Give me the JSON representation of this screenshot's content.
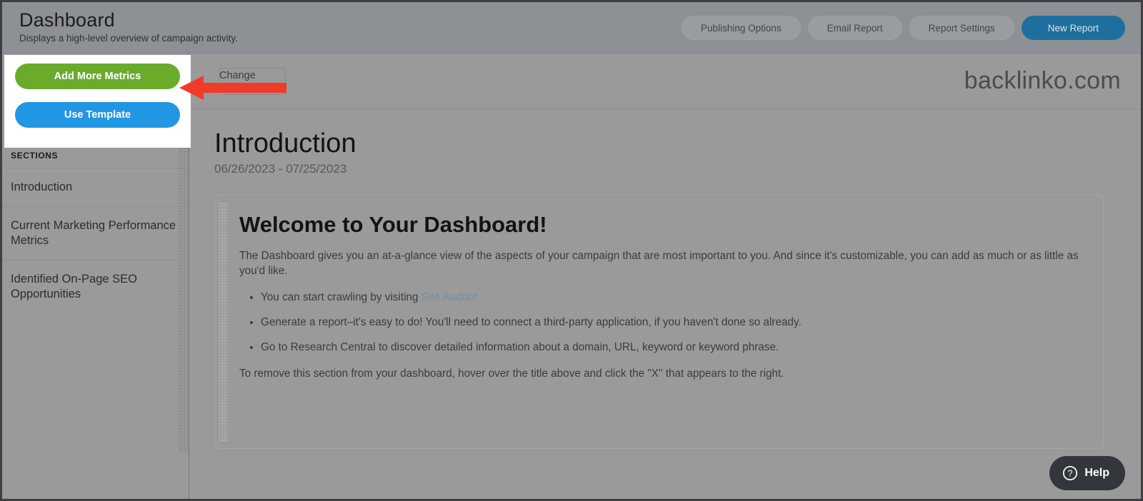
{
  "header": {
    "title": "Dashboard",
    "subtitle": "Displays a high-level overview of campaign activity.",
    "actions": [
      {
        "label": "Publishing Options",
        "style": "outline"
      },
      {
        "label": "Email Report",
        "style": "outline"
      },
      {
        "label": "Report Settings",
        "style": "outline"
      },
      {
        "label": "New Report",
        "style": "primary",
        "color": "#1f6f9e"
      }
    ]
  },
  "highlight_panel": {
    "add_metrics_label": "Add More Metrics",
    "add_metrics_color": "#6aab2c",
    "use_template_label": "Use Template",
    "use_template_color": "#2196e3"
  },
  "annotation": {
    "arrow_color": "#f23a28",
    "arrow_direction": "left",
    "points_at": "Add More Metrics"
  },
  "sidebar": {
    "sections_label": "SECTIONS",
    "items": [
      {
        "label": "Introduction"
      },
      {
        "label": "Current Marketing Performance Metrics"
      },
      {
        "label": "Identified On-Page SEO Opportunities"
      }
    ]
  },
  "brandbar": {
    "logo_button_label": "Change Logo",
    "domain": "backlinko.com"
  },
  "content": {
    "heading": "Introduction",
    "date_range": "06/26/2023 - 07/25/2023",
    "card": {
      "title": "Welcome to Your Dashboard!",
      "intro": "The Dashboard gives you an at-a-glance view of the aspects of your campaign that are most important to you. And since it's customizable, you can add as much or as little as you'd like.",
      "bullets": [
        {
          "text_before": "You can start crawling by visiting ",
          "link": "Site Auditor",
          "text_after": ""
        },
        {
          "text_before": "Generate a report–it's easy to do! You'll need to connect a third-party application, if you haven't done so already.",
          "link": "",
          "text_after": ""
        },
        {
          "text_before": "Go to Research Central to discover detailed information about a domain, URL, keyword or keyword phrase.",
          "link": "",
          "text_after": ""
        }
      ],
      "footer": "To remove this section from your dashboard, hover over the title above and click the \"X\" that appears to the right."
    }
  },
  "help_widget": {
    "label": "Help",
    "icon": "question-circle-icon",
    "background": "#33363b"
  }
}
